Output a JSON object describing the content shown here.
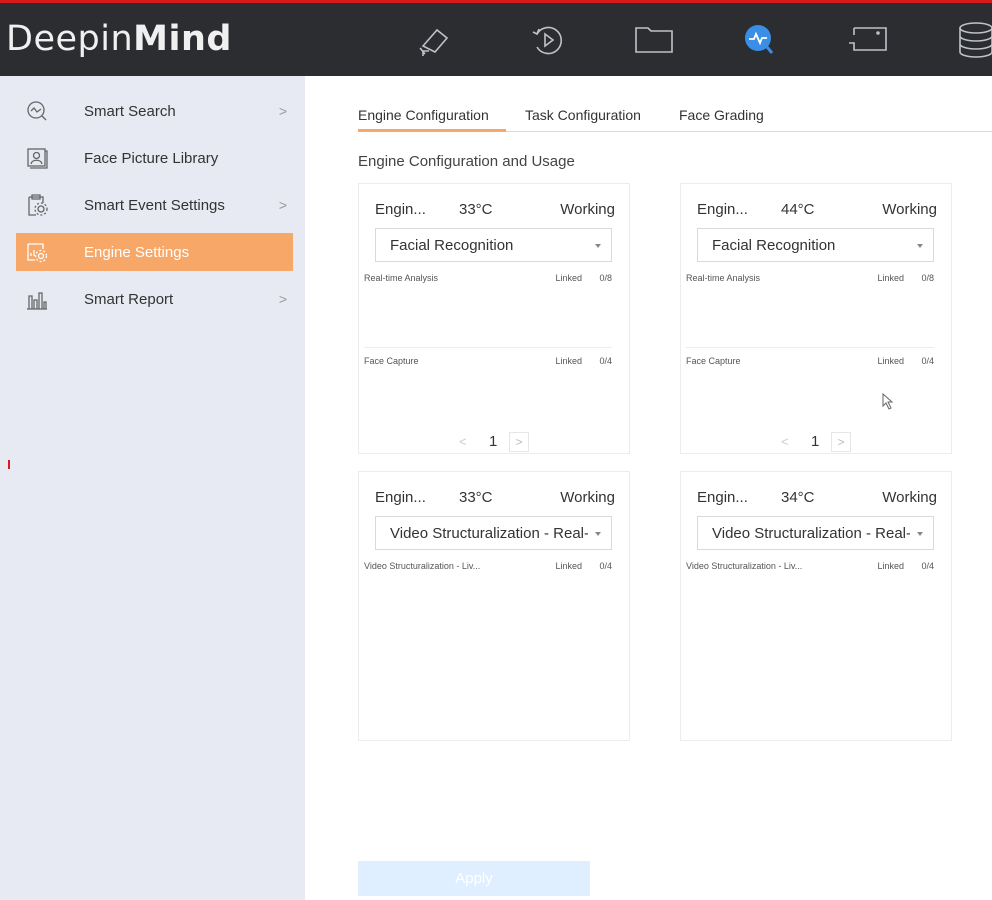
{
  "app": {
    "logo_prefix": "Deepin",
    "logo_bold": "Mind"
  },
  "topnav": [
    {
      "icon": "camera-icon"
    },
    {
      "icon": "playback-icon"
    },
    {
      "icon": "folder-icon"
    },
    {
      "icon": "smart-analysis-icon"
    },
    {
      "icon": "monitor-icon"
    },
    {
      "icon": "storage-icon"
    }
  ],
  "sidebar": {
    "items": [
      {
        "label": "Smart Search",
        "arrow": ">",
        "icon": "smart-search-icon"
      },
      {
        "label": "Face Picture Library",
        "arrow": "",
        "icon": "face-library-icon"
      },
      {
        "label": "Smart Event Settings",
        "arrow": ">",
        "icon": "event-settings-icon"
      },
      {
        "label": "Engine Settings",
        "arrow": "",
        "icon": "engine-settings-icon",
        "active": true
      },
      {
        "label": "Smart Report",
        "arrow": ">",
        "icon": "report-icon"
      }
    ]
  },
  "tabs": [
    {
      "label": "Engine Configuration",
      "active": true
    },
    {
      "label": "Task Configuration"
    },
    {
      "label": "Face Grading"
    }
  ],
  "section_title": "Engine Configuration and Usage",
  "engines": [
    {
      "name": "Engin...",
      "temp": "33°C",
      "status": "Working",
      "mode": "Facial Recognition",
      "rows": [
        {
          "name": "Real-time Analysis",
          "link": "Linked",
          "count": "0/8"
        },
        {
          "name": "Face Capture",
          "link": "Linked",
          "count": "0/4"
        }
      ],
      "pager": {
        "prev": "<",
        "page": "1",
        "next": ">"
      }
    },
    {
      "name": "Engin...",
      "temp": "44°C",
      "status": "Working",
      "mode": "Facial Recognition",
      "rows": [
        {
          "name": "Real-time Analysis",
          "link": "Linked",
          "count": "0/8"
        },
        {
          "name": "Face Capture",
          "link": "Linked",
          "count": "0/4"
        }
      ],
      "pager": {
        "prev": "<",
        "page": "1",
        "next": ">"
      }
    },
    {
      "name": "Engin...",
      "temp": "33°C",
      "status": "Working",
      "mode": "Video Structuralization - Real-time",
      "rows": [
        {
          "name": "Video Structuralization - Liv...",
          "link": "Linked",
          "count": "0/4"
        }
      ]
    },
    {
      "name": "Engin...",
      "temp": "34°C",
      "status": "Working",
      "mode": "Video Structuralization - Real-time",
      "rows": [
        {
          "name": "Video Structuralization - Liv...",
          "link": "Linked",
          "count": "0/4"
        }
      ]
    }
  ],
  "apply_label": "Apply",
  "colors": {
    "accent": "#f7a869",
    "topbar": "#2b2d31",
    "sidebar": "#e7eaf2",
    "active_icon": "#3a8ee6"
  }
}
